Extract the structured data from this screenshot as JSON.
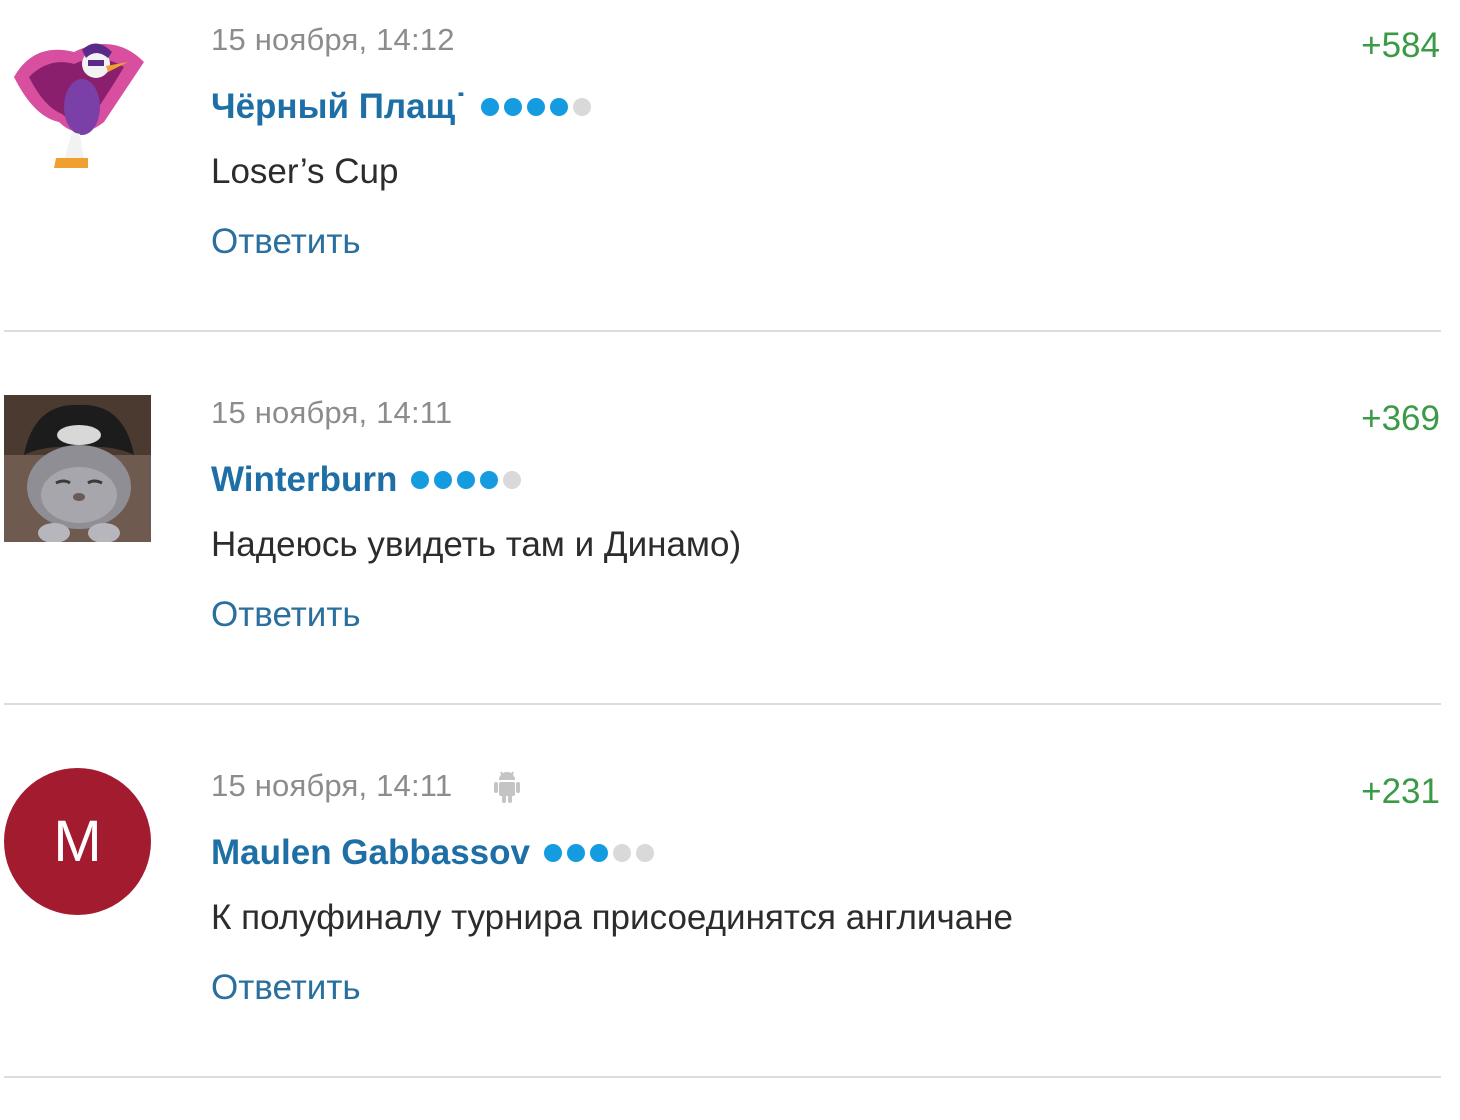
{
  "comments": [
    {
      "timestamp": "15 ноября, 14:12",
      "author": "Чёрный Плащ˙",
      "text": "Loser’s Cup",
      "reply_label": "Ответить",
      "rating": "+584",
      "avatar": "darkwing-duck-avatar",
      "rank_dots_filled": 4,
      "rank_dots_total": 5,
      "has_device_icon": false
    },
    {
      "timestamp": "15 ноября, 14:11",
      "author": "Winterburn",
      "text": "Надеюсь увидеть там и Динамо)",
      "reply_label": "Ответить",
      "rating": "+369",
      "avatar": "cat-in-hat-avatar",
      "rank_dots_filled": 4,
      "rank_dots_total": 5,
      "has_device_icon": false
    },
    {
      "timestamp": "15 ноября, 14:11",
      "author": "Maulen Gabbassov",
      "text": "К полуфиналу турнира присоединятся англичане",
      "reply_label": "Ответить",
      "rating": "+231",
      "avatar": "letter-avatar",
      "avatar_letter": "M",
      "rank_dots_filled": 3,
      "rank_dots_total": 5,
      "has_device_icon": true,
      "device_icon": "android-icon"
    }
  ],
  "colors": {
    "author": "#1d6fa6",
    "reply": "#2a6f9e",
    "rating": "#3a9a46",
    "timestamp": "#8c8c8c",
    "rank_dot_on": "#159be0",
    "rank_dot_off": "#d9d9d9",
    "letter_avatar_bg": "#a31b2e"
  }
}
